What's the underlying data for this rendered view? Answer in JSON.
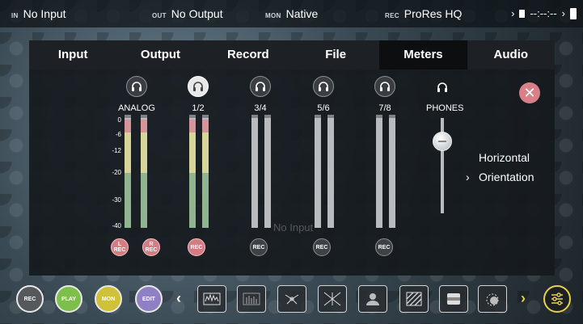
{
  "status": {
    "in_tag": "IN",
    "in_value": "No Input",
    "out_tag": "OUT",
    "out_value": "No Output",
    "mon_tag": "MON",
    "mon_value": "Native",
    "rec_tag": "REC",
    "rec_value": "ProRes HQ",
    "timecode": "--:--:--"
  },
  "tabs": [
    {
      "label": "Input"
    },
    {
      "label": "Output"
    },
    {
      "label": "Record"
    },
    {
      "label": "File"
    },
    {
      "label": "Meters",
      "active": true
    },
    {
      "label": "Audio"
    }
  ],
  "meters": {
    "channels": [
      {
        "label": "ANALOG",
        "headphone_on": false
      },
      {
        "label": "1/2",
        "headphone_on": true
      },
      {
        "label": "3/4",
        "headphone_on": false
      },
      {
        "label": "5/6",
        "headphone_on": false
      },
      {
        "label": "7/8",
        "headphone_on": false
      }
    ],
    "scale": [
      "0",
      "-6",
      "-12",
      "-20",
      "-30",
      "-40"
    ],
    "rec_buttons": [
      "L\nREC",
      "R\nREC",
      "REC",
      "REC",
      "REC",
      "REC"
    ],
    "phones_label": "PHONES",
    "phones_level": 0.82,
    "overlay_text": "No Input",
    "orientation_value": "Horizontal",
    "orientation_label": "Orientation"
  },
  "toolbar": {
    "rec_label": "REC",
    "play_label": "PLAY",
    "mon_label": "MON",
    "edit_label": "EDIT",
    "tools": [
      "waveform-icon",
      "audio-meter-icon",
      "vectorscope-icon",
      "crosshair-icon",
      "false-color-icon",
      "zebra-icon",
      "frame-guide-icon",
      "focus-peaking-icon"
    ]
  },
  "colors": {
    "accent_yellow": "#e8d24a",
    "rec_red": "#d47c84",
    "play_green": "#7cbf4a",
    "mon_yellow": "#cfc13a",
    "edit_purple": "#8f7fc3"
  }
}
